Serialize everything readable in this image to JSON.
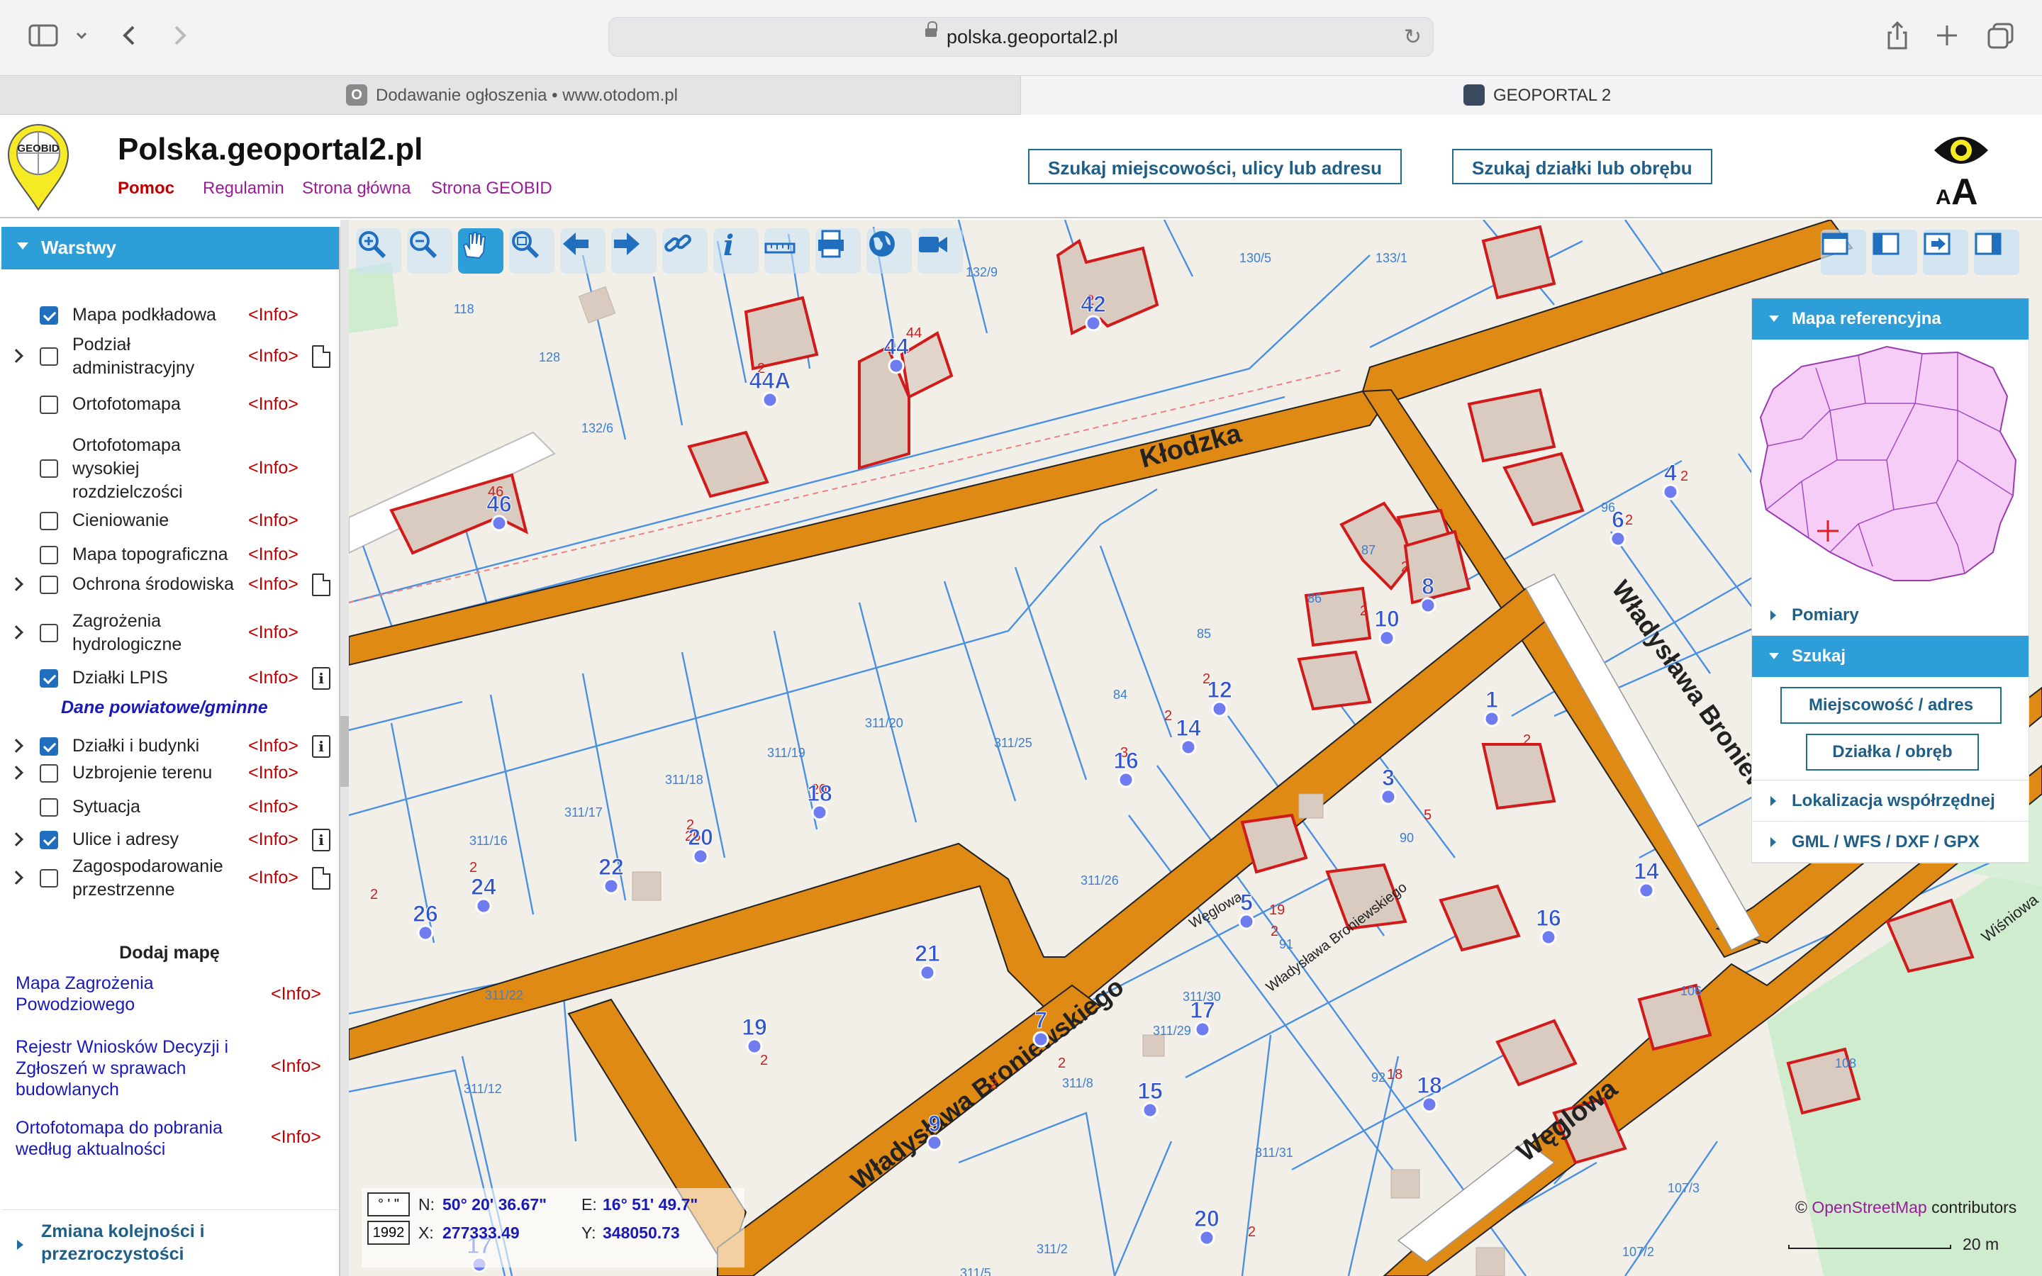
{
  "browser": {
    "url": "polska.geoportal2.pl",
    "tabs": [
      {
        "title": "Dodawanie ogłoszenia • www.otodom.pl",
        "favicon": "O",
        "active": false
      },
      {
        "title": "GEOPORTAL 2",
        "active": true
      }
    ]
  },
  "header": {
    "logo_text": "GEOBID",
    "title": "Polska.geoportal2.pl",
    "links": [
      {
        "label": "Pomoc",
        "color": "#c00000"
      },
      {
        "label": "Regulamin",
        "color": "#9a1c9a"
      },
      {
        "label": "Strona główna",
        "color": "#9a1c9a"
      },
      {
        "label": "Strona GEOBID",
        "color": "#9a1c9a"
      }
    ],
    "search_place_label": "Szukaj miejscowości, ulicy lub adresu",
    "search_parcel_label": "Szukaj działki lub obrębu",
    "accessibility_label": "AA"
  },
  "sidebar": {
    "heading": "Warstwy",
    "info_label": "<Info>",
    "layers": [
      {
        "label": "Mapa podkładowa",
        "checked": true,
        "expandable": false,
        "doc": ""
      },
      {
        "label": "Podział administracyjny",
        "checked": false,
        "expandable": true,
        "doc": "page"
      },
      {
        "label": "Ortofotomapa",
        "checked": false,
        "expandable": false,
        "doc": ""
      },
      {
        "label": "Ortofotomapa wysokiej rozdzielczości",
        "checked": false,
        "expandable": false,
        "doc": ""
      },
      {
        "label": "Cieniowanie",
        "checked": false,
        "expandable": false,
        "doc": ""
      },
      {
        "label": "Mapa topograficzna",
        "checked": false,
        "expandable": false,
        "doc": ""
      },
      {
        "label": "Ochrona środowiska",
        "checked": false,
        "expandable": true,
        "doc": "page"
      },
      {
        "label": "Zagrożenia hydrologiczne",
        "checked": false,
        "expandable": true,
        "doc": ""
      },
      {
        "label": "Działki LPIS",
        "checked": true,
        "expandable": false,
        "doc": "info"
      },
      {
        "label": "Działki i budynki",
        "checked": true,
        "expandable": true,
        "doc": "info"
      },
      {
        "label": "Uzbrojenie terenu",
        "checked": false,
        "expandable": true,
        "doc": ""
      },
      {
        "label": "Sytuacja",
        "checked": false,
        "expandable": false,
        "doc": ""
      },
      {
        "label": "Ulice i adresy",
        "checked": true,
        "expandable": true,
        "doc": "info"
      },
      {
        "label": "Zagospodarowanie przestrzenne",
        "checked": false,
        "expandable": true,
        "doc": "page"
      }
    ],
    "section_label": "Dane powiatowe/gminne",
    "add_map_heading": "Dodaj mapę",
    "add_maps": [
      "Mapa Zagrożenia Powodziowego",
      "Rejestr Wniosków Decyzji i Zgłoszeń w sprawach budowlanych",
      "Ortofotomapa do pobrania według aktualności"
    ],
    "footer_label": "Zmiana kolejności i przezroczystości"
  },
  "map": {
    "tools": [
      "zoom-in",
      "zoom-out",
      "pan",
      "zoom-box",
      "previous",
      "next",
      "link",
      "info",
      "measure",
      "print",
      "globe",
      "camera"
    ],
    "streets": [
      "Kłodzka",
      "Władysława Broniewskiego",
      "Władysława Broniewskiego",
      "Władysława Broniewskiego",
      "Węglowa",
      "Węglowa",
      "Wiśniowa"
    ],
    "parcels": [
      "130/5",
      "133/1",
      "132/9",
      "118",
      "128",
      "132/6",
      "311/25",
      "311/20",
      "311/19",
      "311/18",
      "311/17",
      "311/16",
      "311/26",
      "311/30",
      "311/29",
      "311/31",
      "311/22",
      "311/12",
      "311/8",
      "311/5",
      "311/2",
      "107/3",
      "107/2",
      "108",
      "106",
      "87",
      "86",
      "85",
      "84",
      "96",
      "90",
      "91",
      "92"
    ],
    "addresses": [
      "42",
      "44",
      "44A",
      "46",
      "4",
      "6",
      "8",
      "10",
      "12",
      "14",
      "16",
      "18",
      "20",
      "22",
      "24",
      "26",
      "1",
      "3",
      "5",
      "7",
      "9",
      "14",
      "16",
      "18",
      "19",
      "21",
      "17",
      "15",
      "17",
      "20"
    ],
    "building_small_labels": [
      "2",
      "44",
      "2",
      "46",
      "2",
      "2",
      "2",
      "2",
      "2",
      "2",
      "3",
      "20",
      "26",
      "2",
      "2",
      "2",
      "2",
      "5",
      "2",
      "19",
      "2",
      "2",
      "18",
      "2",
      "2"
    ],
    "coords": {
      "format_label": "° ' \"",
      "system_label": "1992",
      "n_label": "N:",
      "n": "50° 20' 36.67\"",
      "e_label": "E:",
      "e": "16° 51' 49.7\"",
      "x_label": "X:",
      "x": "277333.49",
      "y_label": "Y:",
      "y": "348050.73"
    },
    "attribution_prefix": "©",
    "attribution_link": "OpenStreetMap",
    "attribution_suffix": "contributors",
    "scale_label": "20 m"
  },
  "right_panel": {
    "reference_map_title": "Mapa referencyjna",
    "pomiary": "Pomiary",
    "szukaj": "Szukaj",
    "btn_place": "Miejscowość / adres",
    "btn_parcel": "Działka / obręb",
    "lokalizacja": "Lokalizacja współrzędnej",
    "export": "GML / WFS / DXF / GPX"
  },
  "colors": {
    "accent": "#2e9ed8",
    "road": "#e08a16",
    "building_outline": "#d11b1b",
    "parcel_line": "#4a90e2",
    "address_label": "#3355cc"
  }
}
